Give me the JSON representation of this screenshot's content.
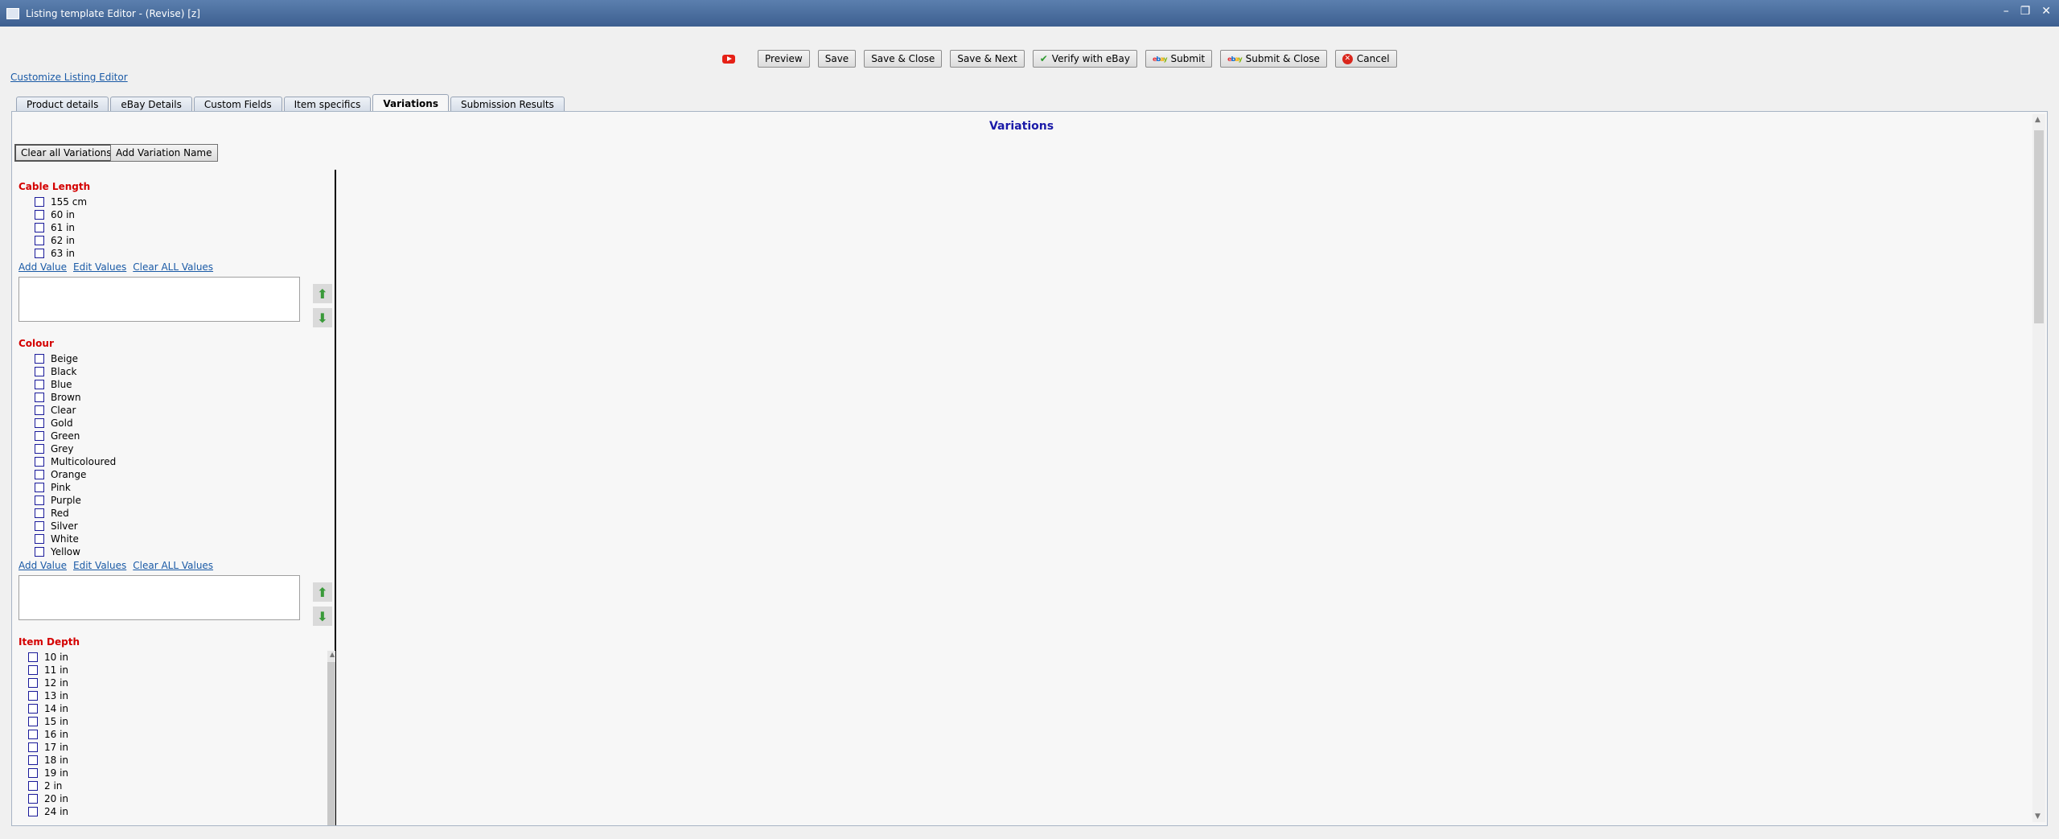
{
  "window": {
    "title": "Listing template Editor - (Revise) [z]"
  },
  "toolbar": {
    "preview": "Preview",
    "save": "Save",
    "save_close": "Save & Close",
    "save_next": "Save & Next",
    "verify": "Verify with eBay",
    "submit": "Submit",
    "submit_close": "Submit & Close",
    "cancel": "Cancel"
  },
  "customize_link": "Customize Listing Editor",
  "tabs": [
    {
      "label": "Product details"
    },
    {
      "label": "eBay Details"
    },
    {
      "label": "Custom Fields"
    },
    {
      "label": "Item specifics"
    },
    {
      "label": "Variations"
    },
    {
      "label": "Submission Results"
    }
  ],
  "panel_title": "Variations",
  "buttons": {
    "clear_all": "Clear all Variations",
    "add_variation": "Add Variation Name"
  },
  "links": {
    "add": "Add Value",
    "edit": "Edit Values",
    "clear": "Clear ALL Values"
  },
  "groups": [
    {
      "name": "Cable Length",
      "values": [
        "155 cm",
        "60 in",
        "61 in",
        "62 in",
        "63 in"
      ]
    },
    {
      "name": "Colour",
      "values": [
        "Beige",
        "Black",
        "Blue",
        "Brown",
        "Clear",
        "Gold",
        "Green",
        "Grey",
        "Multicoloured",
        "Orange",
        "Pink",
        "Purple",
        "Red",
        "Silver",
        "White",
        "Yellow"
      ]
    },
    {
      "name": "Item Depth",
      "values": [
        "10 in",
        "11 in",
        "12 in",
        "13 in",
        "14 in",
        "15 in",
        "16 in",
        "17 in",
        "18 in",
        "19 in",
        "2 in",
        "20 in",
        "24 in"
      ]
    }
  ]
}
